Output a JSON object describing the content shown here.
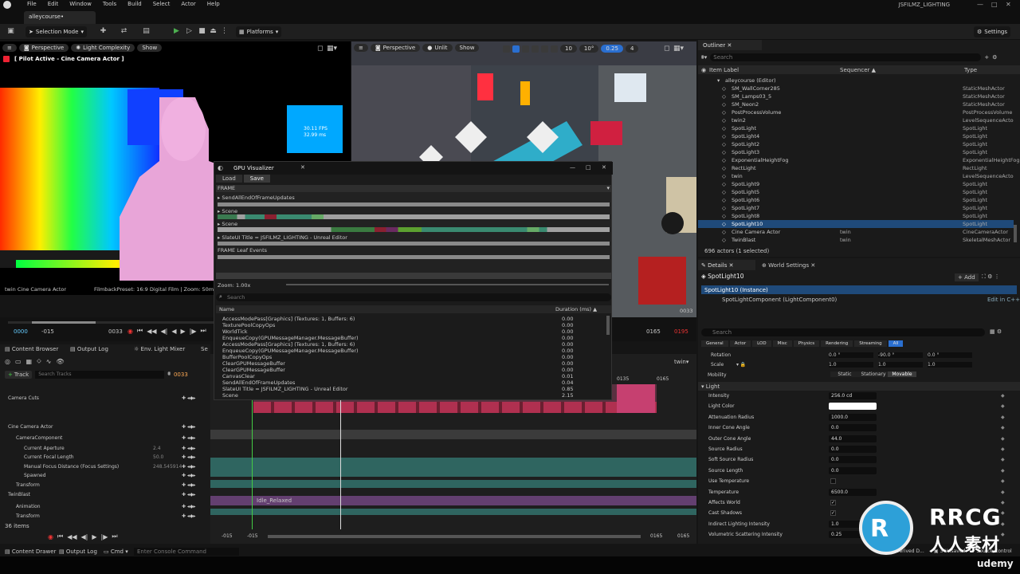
{
  "menu": {
    "items": [
      "File",
      "Edit",
      "Window",
      "Tools",
      "Build",
      "Select",
      "Actor",
      "Help"
    ],
    "project_title": "JSFILMZ_LIGHTING"
  },
  "tab": {
    "label": "alleycourse•"
  },
  "toolbar": {
    "mode": "Selection Mode",
    "platforms": "Platforms",
    "settings": "Settings"
  },
  "left_viewport": {
    "perspective": "Perspective",
    "view_mode": "Light Complexity",
    "show": "Show",
    "pilot": "[ Pilot Active - Cine Camera Actor ]",
    "fps": "30.11 FPS",
    "ms": "32.99 ms",
    "footer_left": "twin Cine Camera Actor",
    "footer_right": "FilmbackPreset: 16:9 Digital Film | Zoom: 50mm | A"
  },
  "right_viewport": {
    "perspective": "Perspective",
    "view_mode": "Unlit",
    "show": "Show",
    "grid": "10",
    "angle": "10°",
    "scale": "0.25",
    "cam": "4",
    "frame": "0033"
  },
  "timeline": {
    "start": "0000",
    "minus15": "-015",
    "current": "0033",
    "end": "0165",
    "plus": "0195"
  },
  "bottom_tabs": {
    "content_browser": "Content Browser",
    "output_log": "Output Log",
    "env_mixer": "Env. Light Mixer",
    "se": "Se"
  },
  "sequencer": {
    "track_btn": "Track",
    "search_placeholder": "Search Tracks",
    "frame": "0033",
    "tracks": [
      {
        "label": "Camera Cuts",
        "indent": 0,
        "value": ""
      },
      {
        "label": "Cine Camera Actor",
        "indent": 0,
        "value": ""
      },
      {
        "label": "CameraComponent",
        "indent": 1,
        "value": ""
      },
      {
        "label": "Current Aperture",
        "indent": 2,
        "value": "2.4"
      },
      {
        "label": "Current Focal Length",
        "indent": 2,
        "value": "50.0"
      },
      {
        "label": "Manual Focus Distance (Focus Settings)",
        "indent": 2,
        "value": "248.545914"
      },
      {
        "label": "Spawned",
        "indent": 2,
        "value": ""
      },
      {
        "label": "Transform",
        "indent": 1,
        "value": ""
      },
      {
        "label": "TwinBlast",
        "indent": 0,
        "value": ""
      },
      {
        "label": "Animation",
        "indent": 1,
        "value": ""
      },
      {
        "label": "Transform",
        "indent": 1,
        "value": ""
      }
    ],
    "items": "36 items",
    "clip": "Idle_Relaxed",
    "timeline_start": "-015",
    "timeline_start2": "-015",
    "timeline_end": "0165",
    "timeline_end2": "0165",
    "twin": "twin▾",
    "marker": "0135",
    "marker2": "0165"
  },
  "gpu": {
    "title": "GPU Visualizer",
    "load": "Load",
    "save": "Save",
    "frame": "FRAME",
    "rows": [
      "SendAllEndOfFrameUpdates",
      "Scene",
      "Scene",
      "SlateUI Title = JSFILMZ_LIGHTING - Unreal Editor",
      "FRAME Leaf Events"
    ],
    "zoom": "Zoom: 1.00x",
    "search": "Search",
    "col_name": "Name",
    "col_duration": "Duration (ms) ▲",
    "list": [
      [
        "AccessModePass[Graphics] (Textures: 1, Buffers: 6)",
        "0.00"
      ],
      [
        "TexturePoolCopyOps",
        "0.00"
      ],
      [
        "WorldTick",
        "0.00"
      ],
      [
        "EnqueueCopy(GPUMessageManager.MessageBuffer)",
        "0.00"
      ],
      [
        "AccessModePass[Graphics] (Textures: 1, Buffers: 6)",
        "0.00"
      ],
      [
        "EnqueueCopy(GPUMessageManager.MessageBuffer)",
        "0.00"
      ],
      [
        "BufferPoolCopyOps",
        "0.00"
      ],
      [
        "ClearGPUMessageBuffer",
        "0.00"
      ],
      [
        "ClearGPUMessageBuffer",
        "0.00"
      ],
      [
        "CanvasClear",
        "0.01"
      ],
      [
        "SendAllEndOfFrameUpdates",
        "0.04"
      ],
      [
        "SlateUI Title = JSFILMZ_LIGHTING - Unreal Editor",
        "0.85"
      ],
      [
        "Scene",
        "2.15"
      ]
    ]
  },
  "outliner": {
    "tab": "Outliner",
    "search": "Search",
    "col_label": "Item Label",
    "col_seq": "Sequencer ▲",
    "col_type": "Type",
    "rows": [
      [
        "alleycourse (Editor)",
        "",
        ""
      ],
      [
        "SM_WallCorner285",
        "",
        "StaticMeshActor"
      ],
      [
        "SM_Lamps03_5",
        "",
        "StaticMeshActor"
      ],
      [
        "SM_Neon2",
        "",
        "StaticMeshActor"
      ],
      [
        "PostProcessVolume",
        "",
        "PostProcessVolume"
      ],
      [
        "twin2",
        "",
        "LevelSequenceActo"
      ],
      [
        "SpotLight",
        "",
        "SpotLight"
      ],
      [
        "SpotLight4",
        "",
        "SpotLight"
      ],
      [
        "SpotLight2",
        "",
        "SpotLight"
      ],
      [
        "SpotLight3",
        "",
        "SpotLight"
      ],
      [
        "ExponentialHeightFog",
        "",
        "ExponentialHeightFog"
      ],
      [
        "RectLight",
        "",
        "RectLight"
      ],
      [
        "twin",
        "",
        "LevelSequenceActo"
      ],
      [
        "SpotLight9",
        "",
        "SpotLight"
      ],
      [
        "SpotLight5",
        "",
        "SpotLight"
      ],
      [
        "SpotLight6",
        "",
        "SpotLight"
      ],
      [
        "SpotLight7",
        "",
        "SpotLight"
      ],
      [
        "SpotLight8",
        "",
        "SpotLight"
      ],
      [
        "SpotLight10",
        "",
        "SpotLight"
      ],
      [
        "Cine Camera Actor",
        "twin",
        "CineCameraActor"
      ],
      [
        "TwinBlast",
        "twin",
        "SkeletalMeshActor"
      ]
    ],
    "footer": "696 actors (1 selected)"
  },
  "details": {
    "tab": "Details",
    "tab2": "World Settings",
    "object": "SpotLight10",
    "add": "+ Add",
    "instance": "SpotLight10 (Instance)",
    "component": "SpotLightComponent (LightComponent0)",
    "edit_cpp": "Edit in C++",
    "search": "Search",
    "filters": [
      "General",
      "Actor",
      "LOD",
      "Misc",
      "Physics",
      "Rendering",
      "Streaming",
      "All"
    ],
    "rotation_label": "Rotation",
    "rotation": [
      "0.0 °",
      "-90.0 °",
      "0.0 °"
    ],
    "scale_label": "Scale",
    "scale": [
      "1.0",
      "1.0",
      "1.0"
    ],
    "mobility_label": "Mobility",
    "mobility": [
      "Static",
      "Stationary",
      "Movable"
    ],
    "light_section": "Light",
    "props": [
      [
        "Intensity",
        "256.0 cd"
      ],
      [
        "Light Color",
        ""
      ],
      [
        "Attenuation Radius",
        "1000.0"
      ],
      [
        "Inner Cone Angle",
        "0.0"
      ],
      [
        "Outer Cone Angle",
        "44.0"
      ],
      [
        "Source Radius",
        "0.0"
      ],
      [
        "Soft Source Radius",
        "0.0"
      ],
      [
        "Source Length",
        "0.0"
      ],
      [
        "Use Temperature",
        ""
      ],
      [
        "Temperature",
        "6500.0"
      ],
      [
        "Affects World",
        ""
      ],
      [
        "Cast Shadows",
        ""
      ],
      [
        "Indirect Lighting Intensity",
        "1.0"
      ],
      [
        "Volumetric Scattering Intensity",
        "0.25"
      ]
    ]
  },
  "statusbar": {
    "content_drawer": "Content Drawer",
    "output_log": "Output Log",
    "cmd": "Cmd ▾",
    "console": "Enter Console Command",
    "derived": "Derived D...",
    "unsaved": "3 Unsaved",
    "source": "Source Control"
  },
  "watermark": {
    "brand": "RRCG",
    "cn": "人人素材",
    "udemy": "udemy"
  }
}
